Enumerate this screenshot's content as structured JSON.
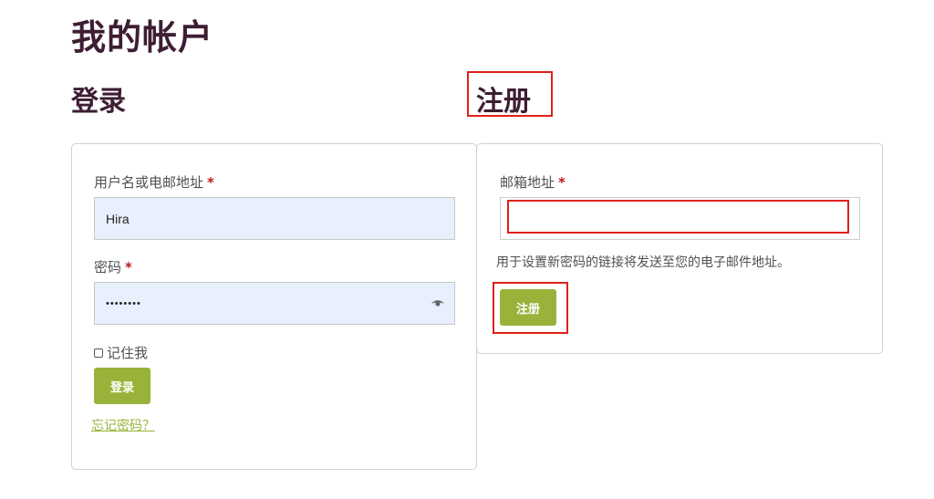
{
  "page": {
    "title": "我的帐户"
  },
  "login": {
    "title": "登录",
    "username_label": "用户名或电邮地址",
    "required_mark": "*",
    "username_value": "Hira",
    "password_label": "密码",
    "password_value": "••••••••",
    "remember_label": "记住我",
    "submit_label": "登录",
    "forgot_label": "忘记密码？"
  },
  "register": {
    "title": "注册",
    "email_label": "邮箱地址",
    "required_mark": "*",
    "email_value": "",
    "hint": "用于设置新密码的链接将发送至您的电子邮件地址。",
    "submit_label": "注册"
  },
  "colors": {
    "heading": "#3d1e33",
    "accent": "#99b33a",
    "required": "#b81c23",
    "highlight": "#e0201b",
    "autofill": "#e8f0fe"
  },
  "icons": {
    "password_toggle": "eye-icon"
  }
}
